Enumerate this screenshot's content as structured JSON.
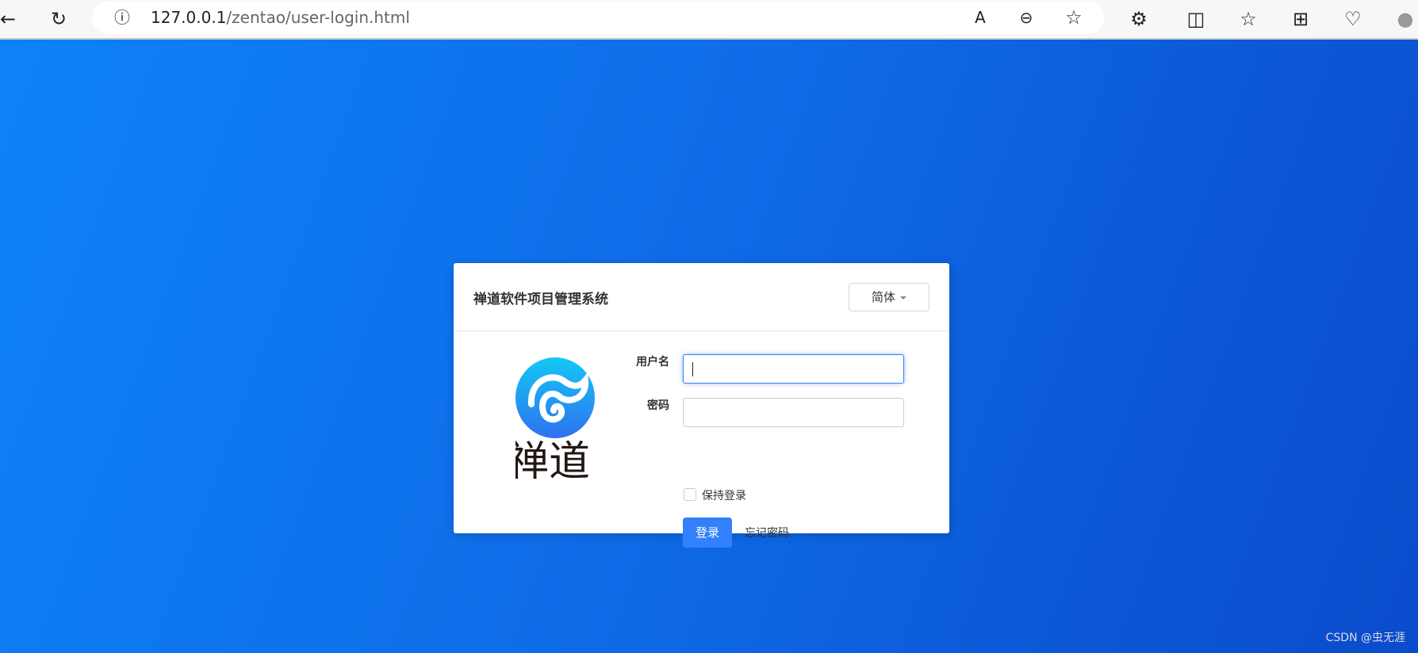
{
  "browser": {
    "url_host": "127.0.0.1",
    "url_path": "/zentao/user-login.html"
  },
  "login": {
    "title": "禅道软件项目管理系统",
    "language": "简体",
    "username_label": "用户名",
    "username_value": "",
    "password_label": "密码",
    "password_value": "",
    "keep_login": "保持登录",
    "login_button": "登录",
    "forgot_password": "忘记密码",
    "logo_text": "禅道"
  },
  "watermark": "CSDN @虫无涯",
  "colors": {
    "accent": "#3280fc",
    "background": "#0f6de8"
  }
}
